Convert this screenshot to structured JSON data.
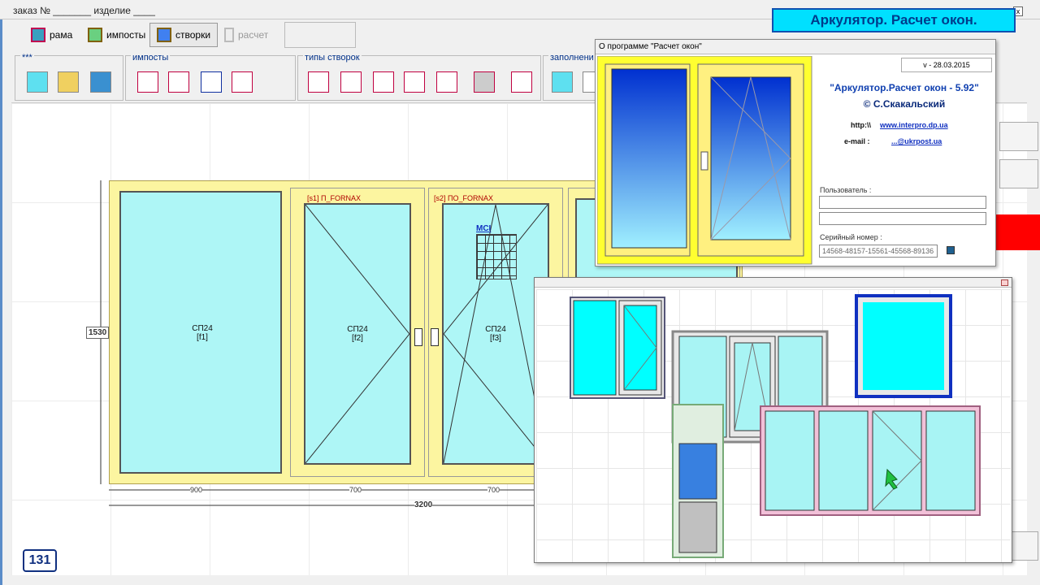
{
  "window": {
    "title": "заказ № _______ изделие ____",
    "close": "x"
  },
  "brand": "Аркулятор. Расчет окон.",
  "toolbar": {
    "frame_label": "рама",
    "imposts_label": "импосты",
    "sashes_label": "створки",
    "calc_label": "расчет"
  },
  "groups": {
    "misc": "***",
    "imposts": "импосты",
    "sash_types": "типы створок",
    "fill": "заполнени"
  },
  "drawing": {
    "pane1_code": "СП24",
    "pane1_id": "[f1]",
    "pane2_code": "СП24",
    "pane2_id": "[f2]",
    "pane3_code": "СП24",
    "pane3_id": "[f3]",
    "sash1_title": "[s1] П_FORNAX",
    "sash2_title": "[s2] ПО_FORNAX",
    "net_label": "МСІ",
    "height": "1530",
    "width1": "900",
    "width2": "700",
    "width3": "700",
    "total_width": "3200"
  },
  "badge": "131",
  "about": {
    "title": "О программе \"Расчет окон\"",
    "version": "v - 28.03.2015",
    "program_name": "\"Аркулятор.Расчет окон - 5.92\"",
    "author": "© С.Скакальский",
    "http_label": "http:\\\\",
    "http_value": "www.interpro.dp.ua",
    "email_label": "e-mail :",
    "email_value": "...@ukrpost.ua",
    "user_label": "Пользователь :",
    "user_value": "",
    "serial_label": "Серийный номер :",
    "serial_value": "14568-48157-15561-45568-89136"
  },
  "colors": {
    "frame": "#fcf5a0",
    "glass": "#aef6f6",
    "brand_bg": "#00e0ff",
    "accent_red": "#ff0000"
  }
}
